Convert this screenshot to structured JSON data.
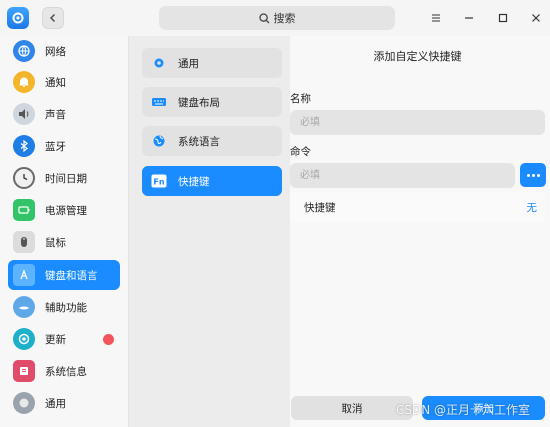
{
  "titlebar": {
    "search_label": "搜索"
  },
  "sidebar": {
    "items": [
      {
        "label": "网络",
        "icon": "network-icon",
        "color": "#2f86e8"
      },
      {
        "label": "通知",
        "icon": "bell-icon",
        "color": "#f3b52a"
      },
      {
        "label": "声音",
        "icon": "speaker-icon",
        "color": "#cfd6de"
      },
      {
        "label": "蓝牙",
        "icon": "bluetooth-icon",
        "color": "#1e7ee6"
      },
      {
        "label": "时间日期",
        "icon": "clock-icon",
        "color": "#f0f0f0"
      },
      {
        "label": "电源管理",
        "icon": "battery-icon",
        "color": "#33c46a"
      },
      {
        "label": "鼠标",
        "icon": "mouse-icon",
        "color": "#dcdcdc"
      },
      {
        "label": "键盘和语言",
        "icon": "keyboard-language-icon",
        "color": "#5cb3ff"
      },
      {
        "label": "辅助功能",
        "icon": "accessibility-icon",
        "color": "#5fa8e8"
      },
      {
        "label": "更新",
        "icon": "update-icon",
        "color": "#1db0c9"
      },
      {
        "label": "系统信息",
        "icon": "system-info-icon",
        "color": "#e04d6a"
      },
      {
        "label": "通用",
        "icon": "general-icon",
        "color": "#9aa3ad"
      }
    ],
    "active_index": 7
  },
  "middle": {
    "items": [
      {
        "label": "通用",
        "icon": "gear-icon"
      },
      {
        "label": "键盘布局",
        "icon": "keyboard-icon"
      },
      {
        "label": "系统语言",
        "icon": "globe-icon"
      },
      {
        "label": "快捷键",
        "icon": "fn-key-icon"
      }
    ],
    "active_index": 3
  },
  "detail": {
    "title": "添加自定义快捷键",
    "name_label": "名称",
    "name_placeholder": "必填",
    "command_label": "命令",
    "command_placeholder": "必填",
    "shortcut_label": "快捷键",
    "shortcut_value": "无",
    "cancel_label": "取消",
    "add_label": "添加"
  },
  "watermark": "CSDN @正月十六工作室",
  "colors": {
    "accent": "#1a8cff",
    "update_badge": "#f2545b"
  }
}
